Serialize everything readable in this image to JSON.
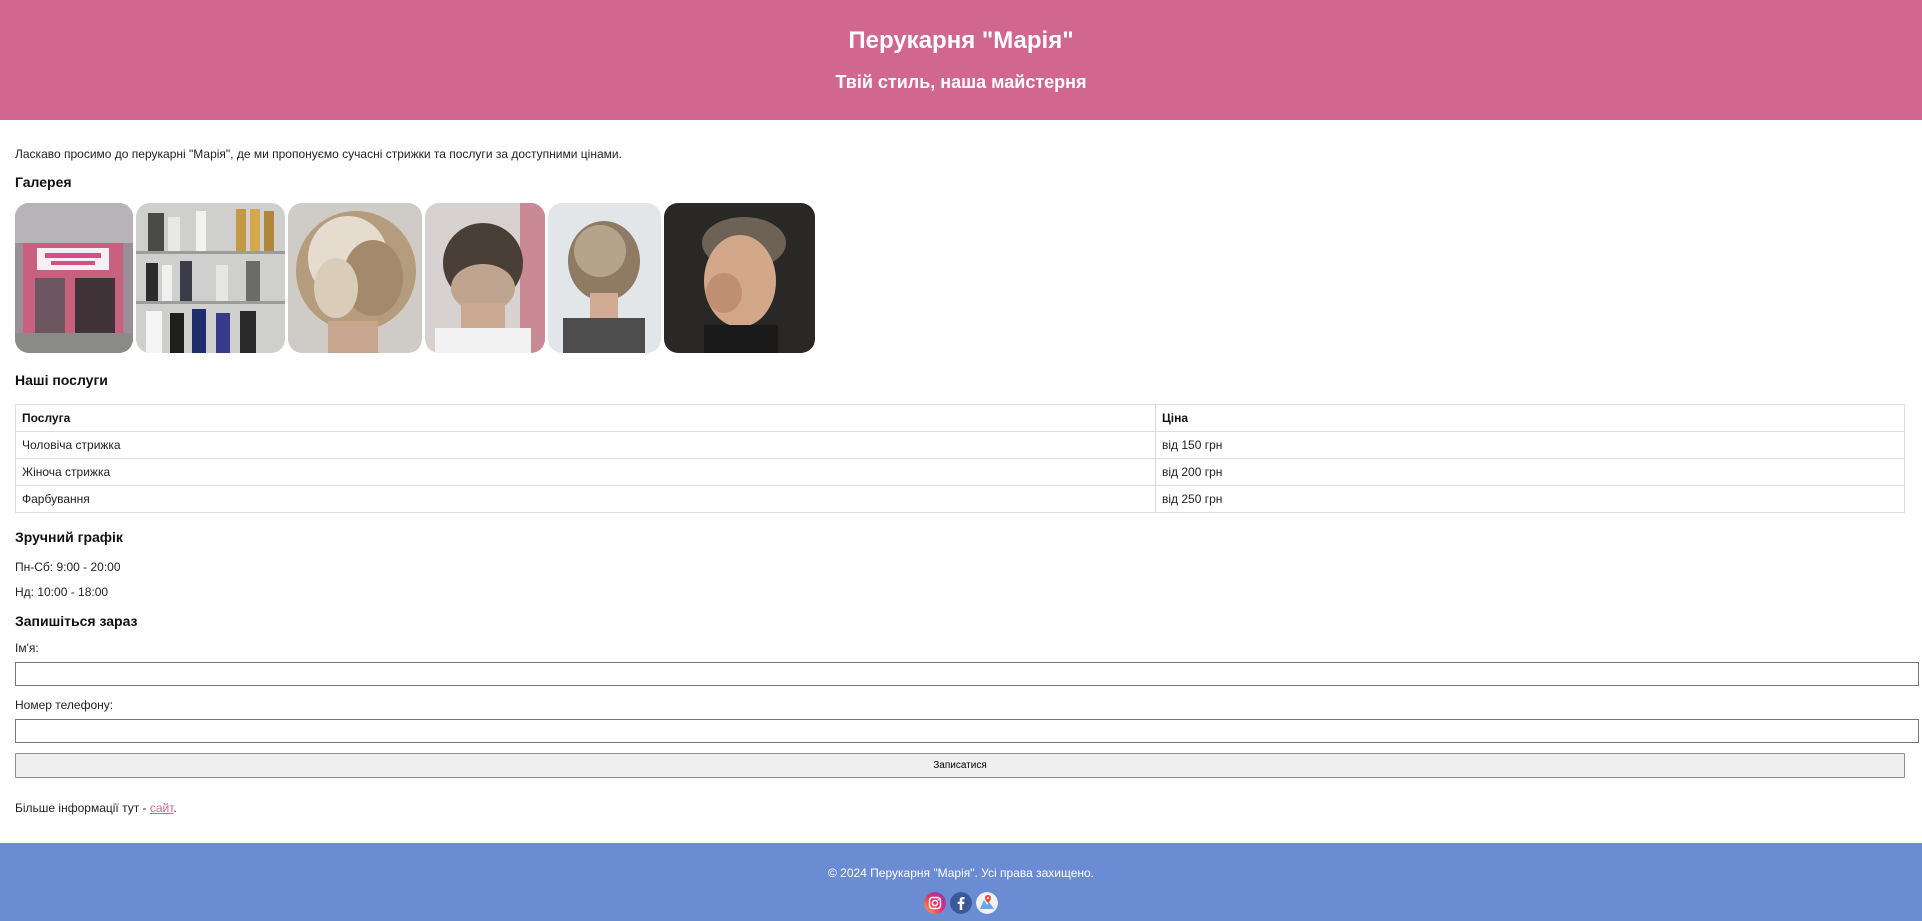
{
  "header": {
    "title": "Перукарня \"Марія\"",
    "tagline": "Твій стиль, наша майстерня"
  },
  "intro": "Ласкаво просимо до перукарні \"Марія\", де ми пропонуємо сучасні стрижки та послуги за доступними цінами.",
  "gallery": {
    "title": "Галерея",
    "images": [
      "salon-exterior",
      "hair-products-shelf",
      "blonde-bob-haircut",
      "men-fade-back-view",
      "short-textured-bob",
      "men-crew-cut-side"
    ]
  },
  "services": {
    "title": "Наші послуги",
    "headers": [
      "Послуга",
      "Ціна"
    ],
    "rows": [
      [
        "Чоловіча стрижка",
        "від 150 грн"
      ],
      [
        "Жіноча стрижка",
        "від 200 грн"
      ],
      [
        "Фарбування",
        "від 250 грн"
      ]
    ]
  },
  "schedule": {
    "title": "Зручний графік",
    "weekdays": "Пн-Сб: 9:00 - 20:00",
    "sunday": "Нд: 10:00 - 18:00"
  },
  "booking": {
    "title": "Запишіться зараз",
    "name_label": "Ім'я:",
    "name_value": "",
    "phone_label": "Номер телефону:",
    "phone_value": "",
    "submit_label": "Записатися"
  },
  "more_info": {
    "prefix": "Більше інформації тут - ",
    "link_text": "сайт",
    "suffix": "."
  },
  "footer": {
    "copyright": "© 2024 Перукарня \"Марія\". Усі права захищено.",
    "socials": [
      "instagram-icon",
      "facebook-icon",
      "google-maps-icon"
    ]
  },
  "colors": {
    "header_bg": "#d1668f",
    "footer_bg": "#6b8cd2",
    "link": "#d1668f"
  }
}
